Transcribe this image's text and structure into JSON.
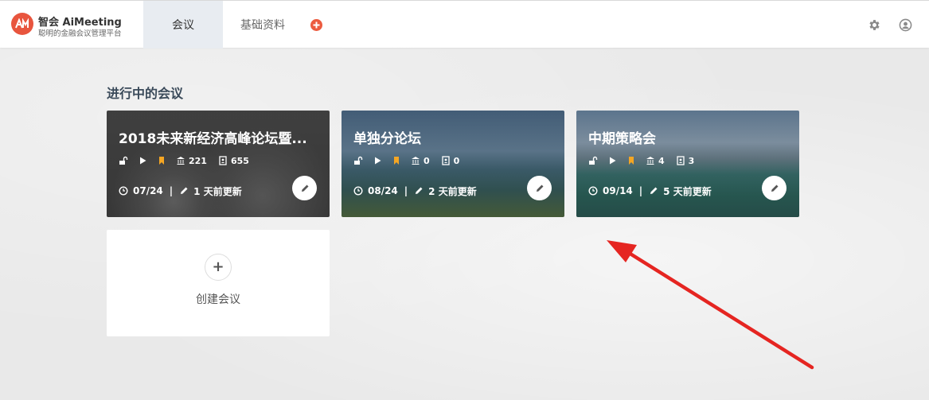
{
  "brand": {
    "title": "智会 AiMeeting",
    "subtitle": "聪明的金融会议管理平台",
    "logo_icon": "aimeeting-logo"
  },
  "nav": {
    "tabs": [
      {
        "label": "会议",
        "active": true
      },
      {
        "label": "基础资料",
        "active": false
      }
    ],
    "add_icon": "plus-circle-icon",
    "settings_icon": "gear-icon",
    "user_icon": "user-circle-icon"
  },
  "section": {
    "title": "进行中的会议"
  },
  "meetings": [
    {
      "title": "2018未来新经济高峰论坛暨...",
      "venues": "221",
      "attendees": "655",
      "date": "07/24",
      "updated": "1 天前更新"
    },
    {
      "title": "单独分论坛",
      "venues": "0",
      "attendees": "0",
      "date": "08/24",
      "updated": "2 天前更新"
    },
    {
      "title": "中期策略会",
      "venues": "4",
      "attendees": "3",
      "date": "09/14",
      "updated": "5 天前更新"
    }
  ],
  "meta_separator": "|",
  "create": {
    "label": "创建会议",
    "plus": "+"
  },
  "colors": {
    "accent": "#e8553e",
    "bookmark": "#f5a623",
    "tab_active_bg": "#e8ecf1",
    "arrow": "#e52521"
  }
}
